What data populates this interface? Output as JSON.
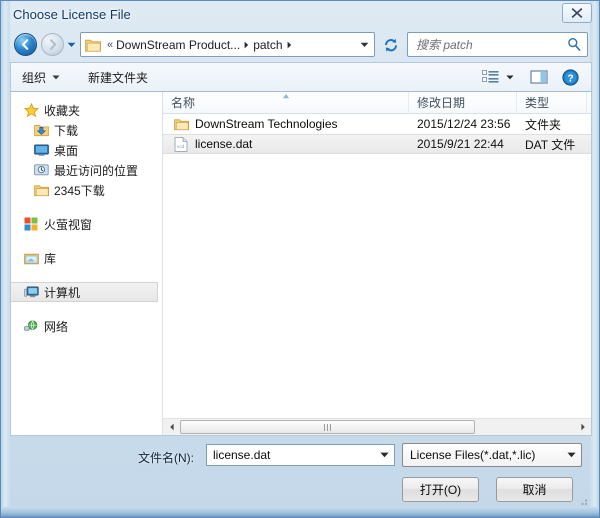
{
  "window": {
    "title": "Choose License File",
    "close_label": "close-icon"
  },
  "address_bar": {
    "back_tooltip": "后退",
    "forward_tooltip": "前进",
    "history_dropdown": "▼",
    "breadcrumb": {
      "overflow": "«",
      "items": [
        "DownStream Product...",
        "patch"
      ],
      "separator": "▶"
    },
    "refresh": "refresh-icon",
    "search_placeholder": "搜索 patch",
    "search_value": ""
  },
  "toolbar": {
    "organize_label": "组织",
    "new_folder_label": "新建文件夹",
    "view_icon": "view-options-icon",
    "preview_icon": "preview-pane-icon",
    "help_icon": "help-icon"
  },
  "sidebar": {
    "groups": [
      {
        "header": "收藏夹",
        "icon": "star-icon",
        "items": [
          {
            "label": "下载",
            "icon": "downloads-icon"
          },
          {
            "label": "桌面",
            "icon": "desktop-icon"
          },
          {
            "label": "最近访问的位置",
            "icon": "recent-places-icon"
          },
          {
            "label": "2345下载",
            "icon": "folder-icon"
          }
        ]
      },
      {
        "header": "火萤视窗",
        "icon": "windows-tiles-icon",
        "items": []
      },
      {
        "header": "库",
        "icon": "libraries-icon",
        "items": []
      },
      {
        "header": "计算机",
        "icon": "computer-icon",
        "items": [],
        "selected": true
      },
      {
        "header": "网络",
        "icon": "network-icon",
        "items": []
      }
    ]
  },
  "file_list": {
    "columns": [
      "名称",
      "修改日期",
      "类型"
    ],
    "sort_column": "名称",
    "sort_direction": "asc",
    "rows": [
      {
        "name": "DownStream Technologies",
        "date": "2015/12/24 23:56",
        "type": "文件夹",
        "icon": "folder-icon",
        "selected": false
      },
      {
        "name": "license.dat",
        "date": "2015/9/21 22:44",
        "type": "DAT 文件",
        "icon": "dat-file-icon",
        "selected": true
      }
    ]
  },
  "bottom": {
    "filename_label": "文件名(N):",
    "filename_value": "license.dat",
    "filter_value": "License Files(*.dat,*.lic)",
    "open_button": "打开(O)",
    "cancel_button": "取消"
  },
  "colors": {
    "title_text": "#123a63",
    "frame_border": "#5a8bbd",
    "accent_blue": "#2a86cf",
    "selection": "#e9e9e9"
  }
}
